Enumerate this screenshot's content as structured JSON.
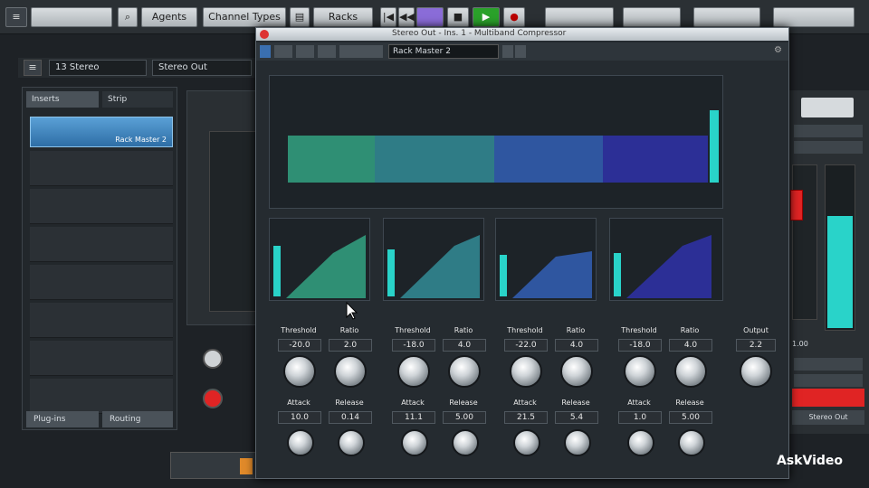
{
  "toolbar": {
    "agents": "Agents",
    "channel_types": "Channel Types",
    "racks": "Racks"
  },
  "channel": {
    "selector": "13 Stereo",
    "output": "Stereo Out"
  },
  "plugin_window": {
    "title": "Stereo Out - Ins. 1 - Multiband Compressor",
    "preset": "Rack Master 2"
  },
  "left_panel": {
    "tabs": [
      "Inserts",
      "Strip"
    ],
    "selected_slot": "Rack Master 2",
    "footer_tabs": [
      "Plug-ins",
      "Routing"
    ]
  },
  "bands": [
    {
      "threshold_label": "Threshold",
      "ratio_label": "Ratio",
      "threshold": "-20.0",
      "ratio": "2.0",
      "attack_label": "Attack",
      "release_label": "Release",
      "attack": "10.0",
      "release": "0.14"
    },
    {
      "threshold_label": "Threshold",
      "ratio_label": "Ratio",
      "threshold": "-18.0",
      "ratio": "4.0",
      "attack_label": "Attack",
      "release_label": "Release",
      "attack": "11.1",
      "release": "5.00"
    },
    {
      "threshold_label": "Threshold",
      "ratio_label": "Ratio",
      "threshold": "-22.0",
      "ratio": "4.0",
      "attack_label": "Attack",
      "release_label": "Release",
      "attack": "21.5",
      "release": "5.4"
    },
    {
      "threshold_label": "Threshold",
      "ratio_label": "Ratio",
      "threshold": "-18.0",
      "ratio": "4.0",
      "attack_label": "Attack",
      "release_label": "Release",
      "attack": "1.0",
      "release": "5.00"
    }
  ],
  "output": {
    "label": "Output",
    "value": "2.2"
  },
  "right_strip": {
    "value": "1.00",
    "output_label": "Stereo Out"
  },
  "watermark": "AskVideo",
  "colors": {
    "band1": "#2f8f74",
    "band2": "#2f7c86",
    "band3": "#2f56a0",
    "band4": "#2c2f96",
    "meter": "#29d3c9",
    "record": "#e02424",
    "play": "#2aa12a",
    "accent": "#8a6cd8"
  }
}
